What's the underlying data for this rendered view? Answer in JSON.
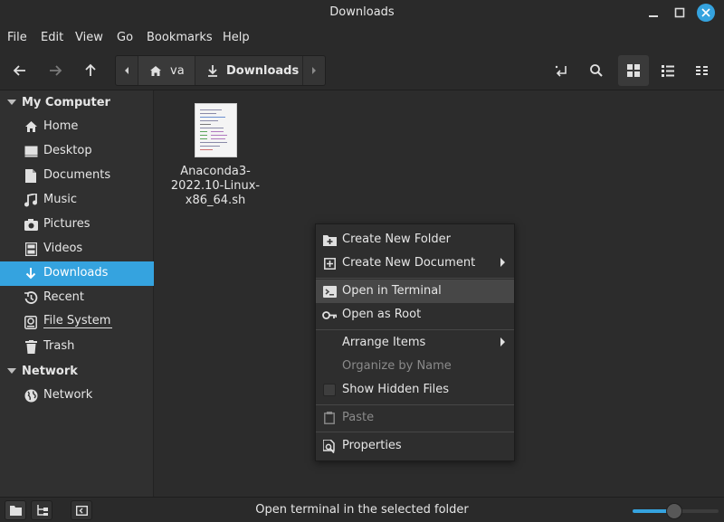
{
  "window": {
    "title": "Downloads"
  },
  "menubar": {
    "file": "File",
    "edit": "Edit",
    "view": "View",
    "go": "Go",
    "bookmarks": "Bookmarks",
    "help": "Help"
  },
  "pathbar": {
    "home_label": "va",
    "current_label": "Downloads"
  },
  "sidebar": {
    "sections": [
      {
        "heading": "My Computer"
      },
      {
        "heading": "Network"
      }
    ],
    "items": [
      {
        "label": "Home",
        "icon": "home-icon"
      },
      {
        "label": "Desktop",
        "icon": "desktop-icon"
      },
      {
        "label": "Documents",
        "icon": "documents-icon"
      },
      {
        "label": "Music",
        "icon": "music-icon"
      },
      {
        "label": "Pictures",
        "icon": "pictures-icon"
      },
      {
        "label": "Videos",
        "icon": "videos-icon"
      },
      {
        "label": "Downloads",
        "icon": "download-icon",
        "active": true
      },
      {
        "label": "Recent",
        "icon": "recent-icon"
      },
      {
        "label": "File System",
        "icon": "drive-icon"
      },
      {
        "label": "Trash",
        "icon": "trash-icon"
      },
      {
        "label": "Network",
        "icon": "globe-icon"
      }
    ]
  },
  "files": [
    {
      "name_line1": "Anaconda3-",
      "name_line2": "2022.10-Linux-",
      "name_line3": "x86_64.sh"
    }
  ],
  "context_menu": {
    "create_folder": "Create New Folder",
    "create_document": "Create New Document",
    "open_terminal": "Open in Terminal",
    "open_root": "Open as Root",
    "arrange_items": "Arrange Items",
    "organize_by_name": "Organize by Name",
    "show_hidden": "Show Hidden Files",
    "paste": "Paste",
    "properties": "Properties"
  },
  "status": {
    "text": "Open terminal in the selected folder",
    "zoom_fraction": 0.48
  },
  "colors": {
    "accent": "#35a3df",
    "window_bg": "#2b2b2b",
    "sidebar_bg": "#303030"
  }
}
